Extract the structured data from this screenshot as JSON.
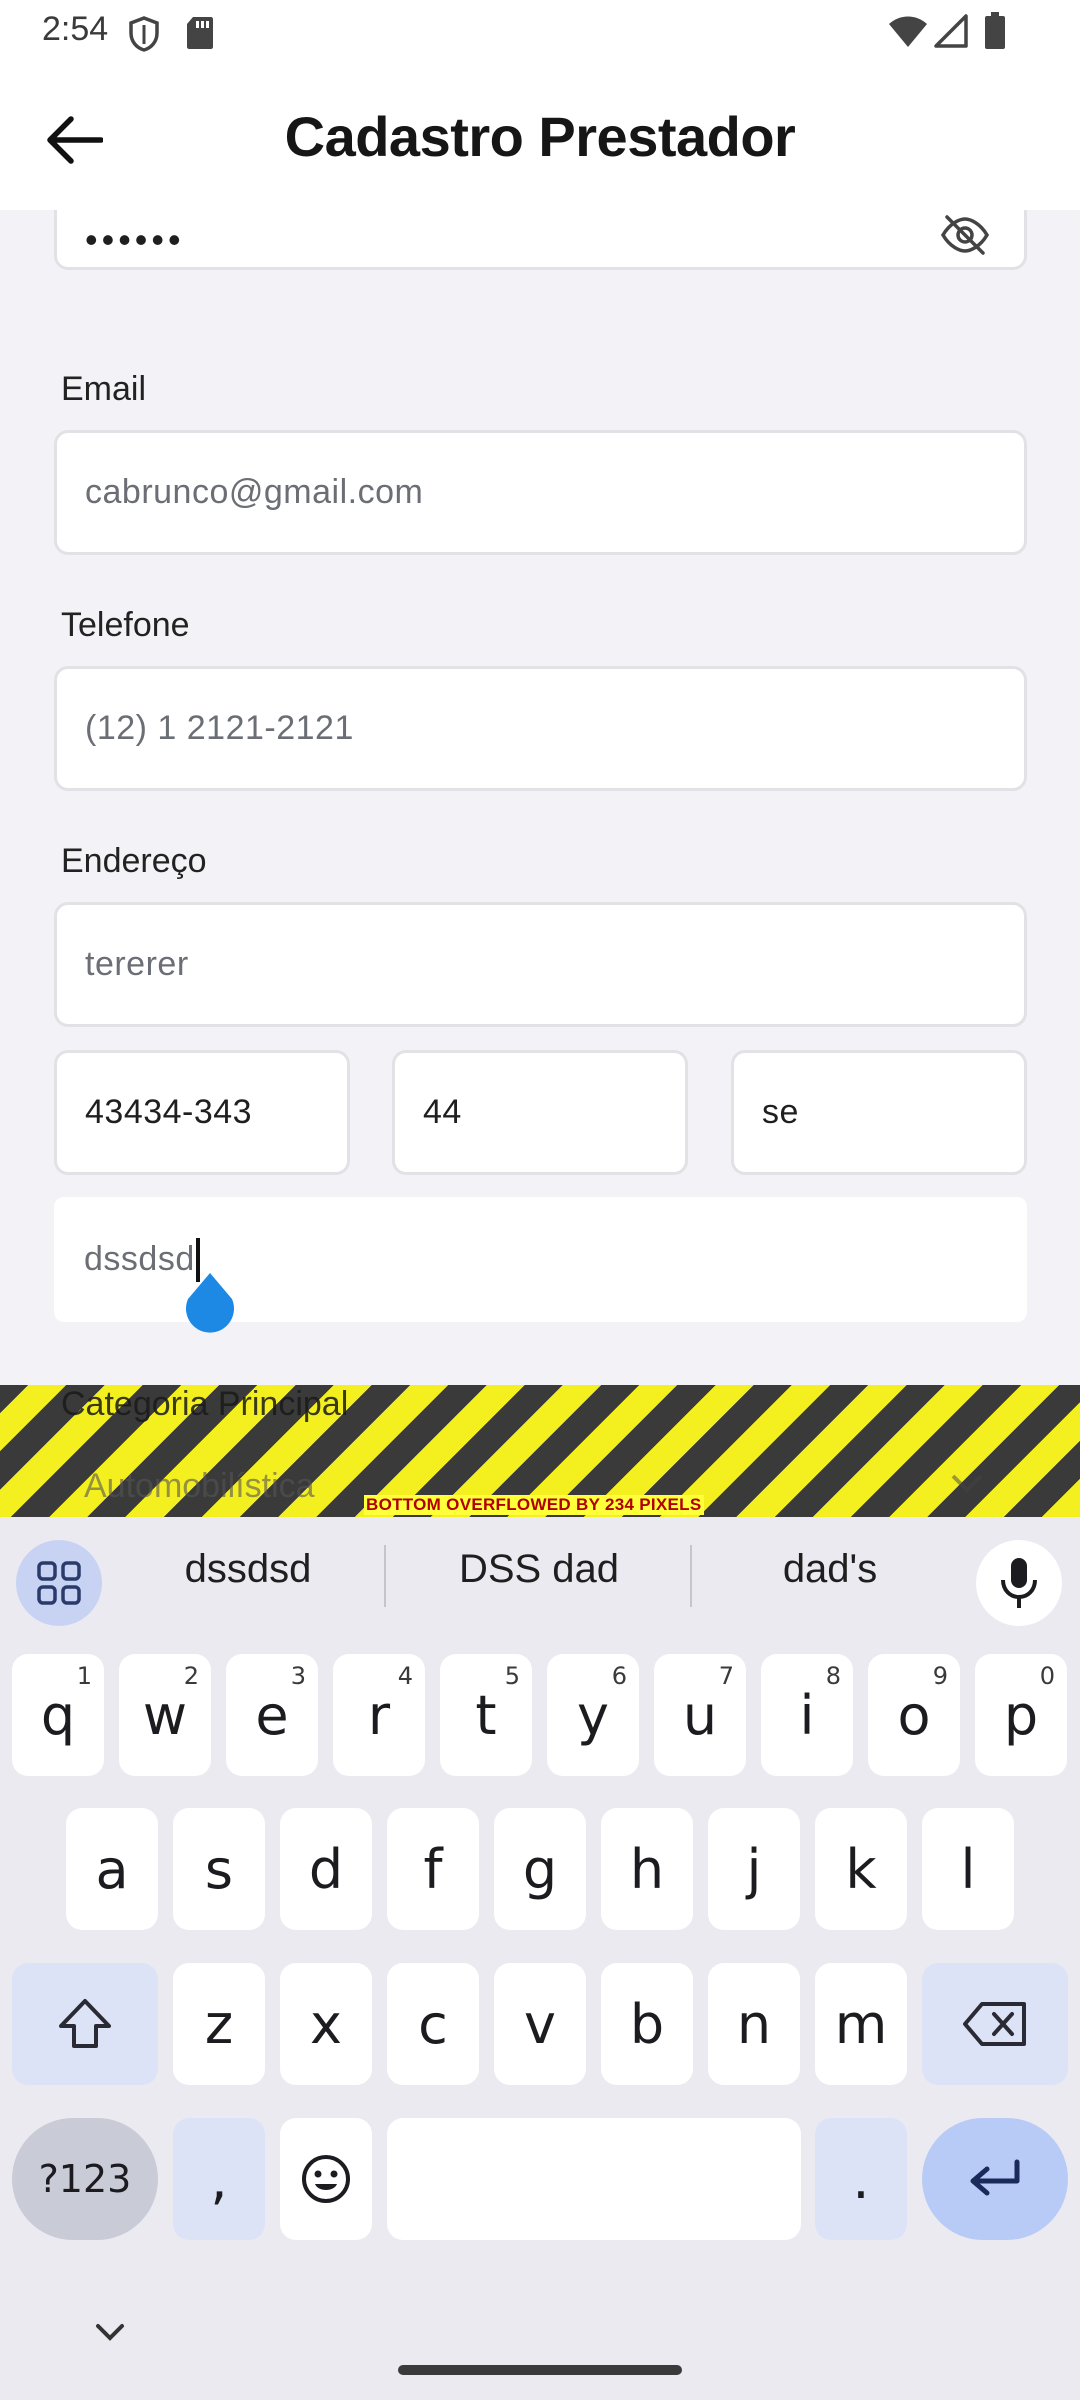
{
  "status_bar": {
    "time": "2:54"
  },
  "app_bar": {
    "title": "Cadastro Prestador"
  },
  "form": {
    "password": {
      "value": "••••••"
    },
    "email": {
      "label": "Email",
      "value": "cabrunco@gmail.com"
    },
    "telefone": {
      "label": "Telefone",
      "value": "(12) 1 2121-2121"
    },
    "endereco": {
      "label": "Endereço",
      "street": "tererer",
      "cep": "43434-343",
      "numero": "44",
      "uf": "se",
      "bairro": "dssdsd"
    },
    "categoria": {
      "label": "Categoria Principal",
      "value": "Automobilística"
    }
  },
  "overflow_banner": {
    "text": "BOTTOM OVERFLOWED BY 234 PIXELS"
  },
  "keyboard": {
    "suggestions": [
      "dssdsd",
      "DSS dad",
      "dad's"
    ],
    "row1": [
      {
        "k": "q",
        "h": "1"
      },
      {
        "k": "w",
        "h": "2"
      },
      {
        "k": "e",
        "h": "3"
      },
      {
        "k": "r",
        "h": "4"
      },
      {
        "k": "t",
        "h": "5"
      },
      {
        "k": "y",
        "h": "6"
      },
      {
        "k": "u",
        "h": "7"
      },
      {
        "k": "i",
        "h": "8"
      },
      {
        "k": "o",
        "h": "9"
      },
      {
        "k": "p",
        "h": "0"
      }
    ],
    "row2": [
      "a",
      "s",
      "d",
      "f",
      "g",
      "h",
      "j",
      "k",
      "l"
    ],
    "row3": [
      "z",
      "x",
      "c",
      "v",
      "b",
      "n",
      "m"
    ],
    "symbols_label": "?123",
    "comma": ",",
    "period": "."
  },
  "colors": {
    "accent": "#1e88e5",
    "key_mod": "#dde3f7",
    "enter": "#b8cbf6",
    "overflow_yellow": "#f4f020",
    "overflow_text": "#b00000"
  }
}
